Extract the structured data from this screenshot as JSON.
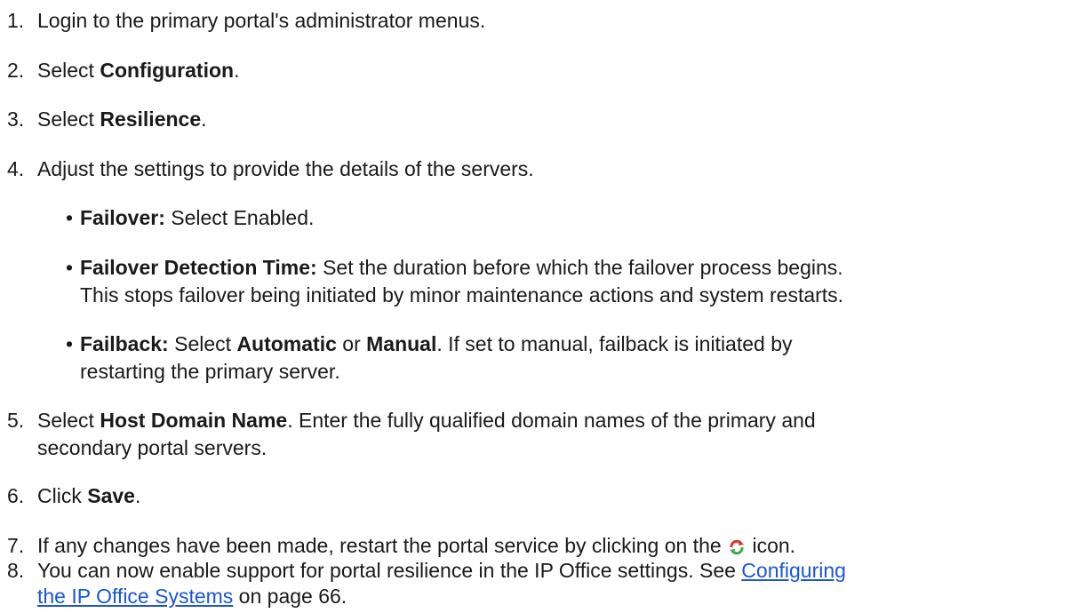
{
  "steps": [
    {
      "num": "1.",
      "text": "Login to the primary portal's administrator menus."
    },
    {
      "num": "2.",
      "pre": "Select ",
      "bold": "Configuration",
      "post": "."
    },
    {
      "num": "3.",
      "pre": "Select ",
      "bold": "Resilience",
      "post": "."
    },
    {
      "num": "4.",
      "text": "Adjust the settings to provide the details of the servers."
    },
    {
      "num": "5.",
      "pre": "Select ",
      "bold": "Host Domain Name",
      "post": ". Enter the fully qualified domain names of the primary and",
      "line2": "secondary portal servers."
    },
    {
      "num": "6.",
      "pre": "Click ",
      "bold": "Save",
      "post": "."
    },
    {
      "num": "7.",
      "pre": "If any changes have been made, restart the portal service by clicking on the ",
      "post": " icon.",
      "icon": "restart-icon"
    },
    {
      "num": "8.",
      "pre": "You can now enable support for portal resilience in the IP Office settings. See ",
      "link_part1": "Configuring",
      "link_part2": "the IP Office Systems",
      "post": " on page 66."
    }
  ],
  "bullets": [
    {
      "dot": "•",
      "bold": "Failover:",
      "text": " Select Enabled."
    },
    {
      "dot": "•",
      "bold": "Failover Detection Time:",
      "text": " Set the duration before which the failover process begins.",
      "line2": "This stops failover being initiated by minor maintenance actions and system restarts."
    },
    {
      "dot": "•",
      "bold": "Failback:",
      "pre": " Select ",
      "bold2": "Automatic",
      "mid": " or ",
      "bold3": "Manual",
      "post": ". If set to manual, failback is initiated by",
      "line2": "restarting the primary server."
    }
  ],
  "colors": {
    "text": "#1a1a1a",
    "link": "#1a56d6",
    "icon_red": "#d9342b",
    "icon_green": "#3aa845"
  }
}
